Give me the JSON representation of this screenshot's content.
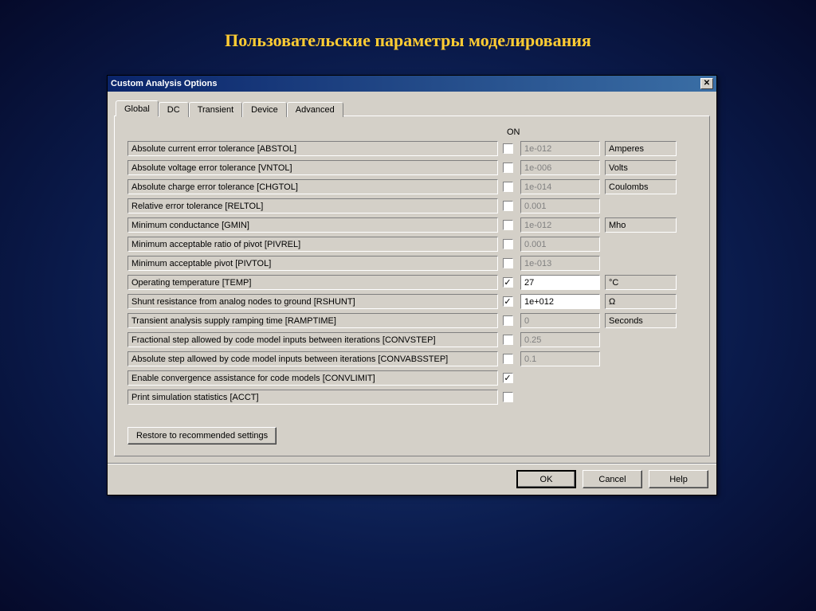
{
  "slide": {
    "title": "Пользовательские параметры моделирования"
  },
  "dialog": {
    "title": "Custom Analysis Options",
    "close": "✕",
    "tabs": [
      "Global",
      "DC",
      "Transient",
      "Device",
      "Advanced"
    ],
    "active_tab": 0,
    "on_header": "ON",
    "rows": [
      {
        "label": "Absolute current error tolerance [ABSTOL]",
        "checked": false,
        "value": "1e-012",
        "enabled": false,
        "unit": "Amperes"
      },
      {
        "label": "Absolute voltage error tolerance [VNTOL]",
        "checked": false,
        "value": "1e-006",
        "enabled": false,
        "unit": "Volts"
      },
      {
        "label": "Absolute charge error tolerance [CHGTOL]",
        "checked": false,
        "value": "1e-014",
        "enabled": false,
        "unit": "Coulombs"
      },
      {
        "label": "Relative error tolerance [RELTOL]",
        "checked": false,
        "value": "0.001",
        "enabled": false,
        "unit": ""
      },
      {
        "label": "Minimum conductance [GMIN]",
        "checked": false,
        "value": "1e-012",
        "enabled": false,
        "unit": "Mho"
      },
      {
        "label": "Minimum acceptable ratio of pivot [PIVREL]",
        "checked": false,
        "value": "0.001",
        "enabled": false,
        "unit": ""
      },
      {
        "label": "Minimum acceptable pivot [PIVTOL]",
        "checked": false,
        "value": "1e-013",
        "enabled": false,
        "unit": ""
      },
      {
        "label": "Operating temperature [TEMP]",
        "checked": true,
        "value": "27",
        "enabled": true,
        "unit": "°C"
      },
      {
        "label": "Shunt resistance from analog nodes to ground [RSHUNT]",
        "checked": true,
        "value": "1e+012",
        "enabled": true,
        "unit": "Ω"
      },
      {
        "label": "Transient analysis supply ramping time [RAMPTIME]",
        "checked": false,
        "value": "0",
        "enabled": false,
        "unit": "Seconds"
      },
      {
        "label": "Fractional step allowed by code model inputs between iterations [CONVSTEP]",
        "checked": false,
        "value": "0.25",
        "enabled": false,
        "unit": ""
      },
      {
        "label": "Absolute step allowed by code model inputs between iterations [CONVABSSTEP]",
        "checked": false,
        "value": "0.1",
        "enabled": false,
        "unit": ""
      },
      {
        "label": "Enable convergence assistance for code models [CONVLIMIT]",
        "checked": true,
        "value": null,
        "enabled": false,
        "unit": ""
      },
      {
        "label": "Print simulation statistics [ACCT]",
        "checked": false,
        "value": null,
        "enabled": false,
        "unit": ""
      }
    ],
    "restore_label": "Restore to recommended settings",
    "buttons": {
      "ok": "OK",
      "cancel": "Cancel",
      "help": "Help"
    }
  }
}
